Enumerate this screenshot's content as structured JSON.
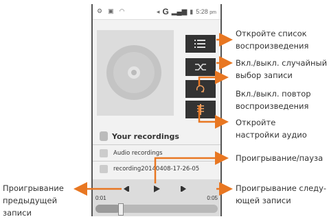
{
  "status": {
    "time": "5:28",
    "ampm": "pm",
    "signal": "G"
  },
  "player": {
    "recordings_title": "Your recordings",
    "folder_label": "Audio recordings",
    "file_name": "recording20140408-17-26-05",
    "elapsed": "0:01",
    "duration": "0:05",
    "progress": 0.2
  },
  "annotations": {
    "playlist": [
      "Откройте список",
      "воспроизведения"
    ],
    "shuffle": [
      "Вкл./выкл. случайный",
      "выбор записи"
    ],
    "repeat": [
      "Вкл./выкл. повтор",
      "воспроизведения"
    ],
    "settings": [
      "Откройте",
      "настройки аудио"
    ],
    "playpause": [
      "Проигрывание/пауза"
    ],
    "next": [
      "Проигрывание следу-",
      "ющей записи"
    ],
    "previous": [
      "Проигрывание",
      "предыдущей",
      "записи"
    ]
  },
  "colors": {
    "accent": "#e87722",
    "button": "#333333",
    "panel": "#dcdcdc"
  }
}
